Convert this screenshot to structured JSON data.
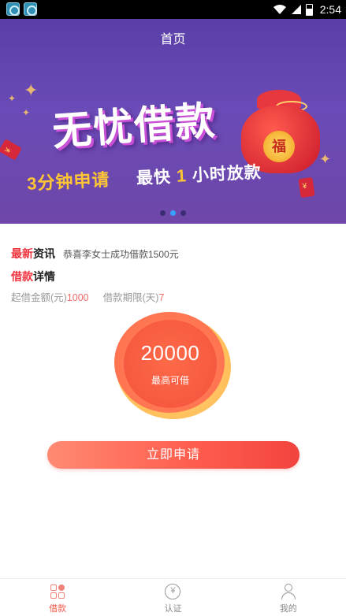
{
  "status_bar": {
    "time": "2:54",
    "icons": [
      "app-icon",
      "app-icon",
      "wifi-icon",
      "signal-icon",
      "battery-icon"
    ]
  },
  "header": {
    "title": "首页"
  },
  "banner": {
    "headline": "无忧借款",
    "sub_part1": "3分钟申请",
    "sub_part2": "最快",
    "sub_highlight": "1",
    "sub_part3": "小时放款",
    "coin_text": "福",
    "carousel": {
      "count": 3,
      "active_index": 1
    }
  },
  "news": {
    "tag_red": "最新",
    "tag_dark": "资讯",
    "text": "恭喜李女士成功借款1500元"
  },
  "detail": {
    "tag_red": "借款",
    "tag_dark": "详情",
    "min_amount_label": "起借金额(元)",
    "min_amount_value": "1000",
    "term_label": "借款期限(天)",
    "term_value": "7"
  },
  "quota": {
    "amount": "20000",
    "label": "最高可借"
  },
  "apply_button": {
    "label": "立即申请"
  },
  "tabbar": {
    "tabs": [
      {
        "label": "借款",
        "icon": "loan-icon",
        "active": true
      },
      {
        "label": "认证",
        "icon": "yuan-coin-icon",
        "active": false
      },
      {
        "label": "我的",
        "icon": "person-icon",
        "active": false
      }
    ]
  },
  "colors": {
    "accent": "#f05a4a",
    "header_bg": "#5a3fa8",
    "highlight_yellow": "#ffc634"
  }
}
